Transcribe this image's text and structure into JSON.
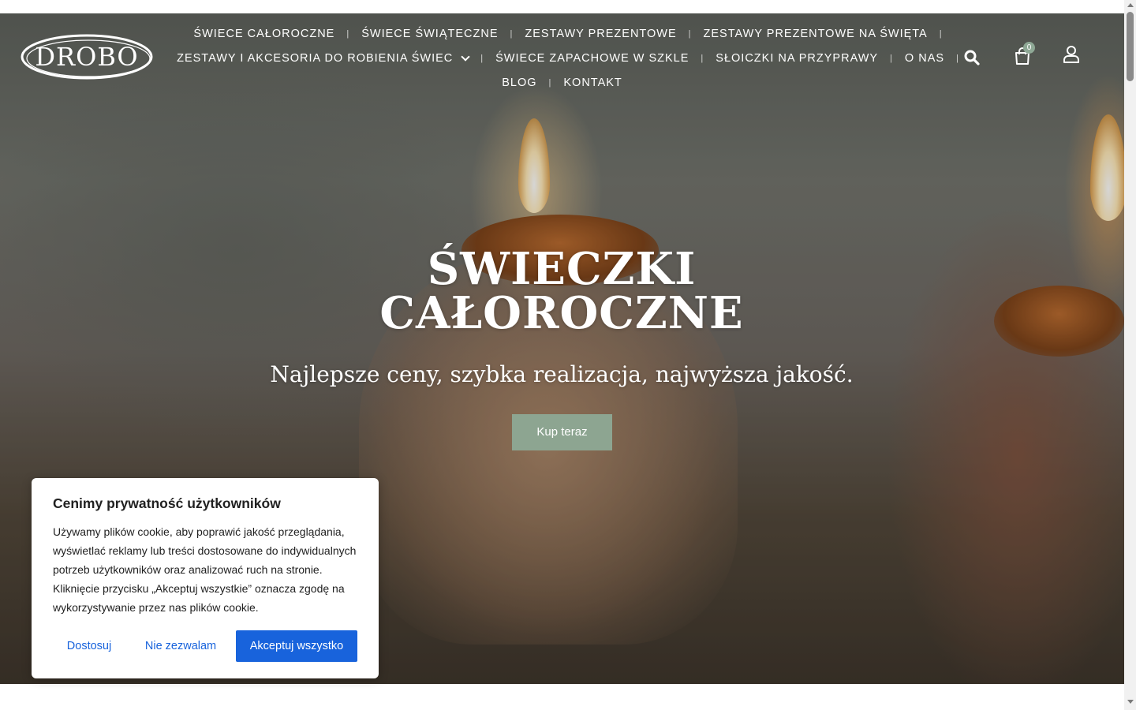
{
  "header": {
    "logo_text": "DROBO",
    "nav": {
      "row1": [
        {
          "label": "ŚWIECE CAŁOROCZNE"
        },
        {
          "label": "ŚWIECE ŚWIĄTECZNE"
        },
        {
          "label": "ZESTAWY PREZENTOWE"
        },
        {
          "label": "ZESTAWY PREZENTOWE NA ŚWIĘTA"
        }
      ],
      "row2": [
        {
          "label": "ZESTAWY I AKCESORIA DO ROBIENIA ŚWIEC"
        },
        {
          "label": "ŚWIECE ZAPACHOWE W SZKLE"
        },
        {
          "label": "SŁOICZKI NA PRZYPRAWY"
        },
        {
          "label": "O NAS"
        }
      ],
      "row3": [
        {
          "label": "BLOG"
        },
        {
          "label": "KONTAKT"
        }
      ],
      "separator": "|"
    },
    "icons": {
      "search": "search-icon",
      "cart": "cart-icon",
      "user": "user-icon"
    },
    "cart_count": "0"
  },
  "hero": {
    "title_line1": "ŚWIECZKI",
    "title_line2": "CAŁOROCZNE",
    "subtitle": "Najlepsze ceny, szybka realizacja, najwyższa jakość.",
    "cta_label": "Kup teraz"
  },
  "cookie_banner": {
    "title": "Cenimy prywatność użytkowników",
    "text": "Używamy plików cookie, aby poprawić jakość przeglądania, wyświetlać reklamy lub treści dostosowane do indywidualnych potrzeb użytkowników oraz analizować ruch na stronie. Kliknięcie przycisku „Akceptuj wszystkie” oznacza zgodę na wykorzystywanie przez nas plików cookie.",
    "customize_label": "Dostosuj",
    "reject_label": "Nie zezwalam",
    "accept_label": "Akceptuj wszystko"
  },
  "colors": {
    "accent_green": "#8da591",
    "cookie_blue": "#1863dc",
    "badge_green": "#8ea895"
  }
}
